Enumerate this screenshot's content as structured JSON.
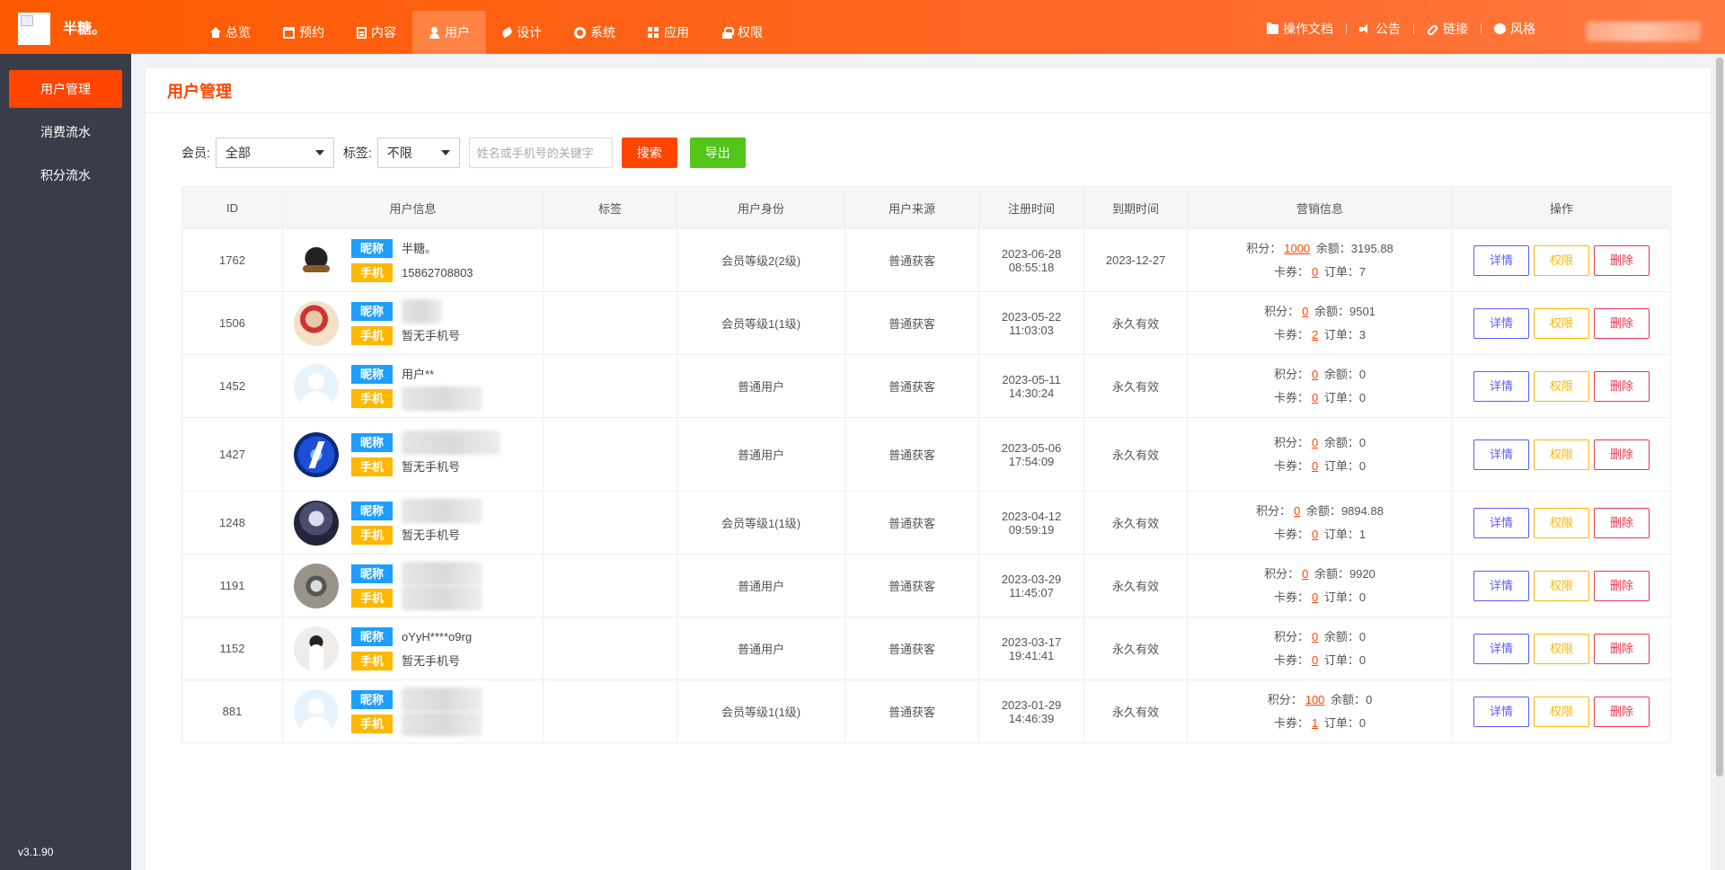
{
  "brand": {
    "name": "半糖。"
  },
  "nav": [
    {
      "label": "总览",
      "icon": "home-icon"
    },
    {
      "label": "预约",
      "icon": "calendar-icon"
    },
    {
      "label": "内容",
      "icon": "document-icon"
    },
    {
      "label": "用户",
      "icon": "user-icon",
      "active": true
    },
    {
      "label": "设计",
      "icon": "brush-icon"
    },
    {
      "label": "系统",
      "icon": "gear-icon"
    },
    {
      "label": "应用",
      "icon": "grid-icon"
    },
    {
      "label": "权限",
      "icon": "lock-icon"
    }
  ],
  "right_links": [
    {
      "label": "操作文档",
      "icon": "folder-icon"
    },
    {
      "label": "公告",
      "icon": "speaker-icon"
    },
    {
      "label": "链接",
      "icon": "link-icon"
    },
    {
      "label": "风格",
      "icon": "palette-icon"
    }
  ],
  "sidebar": {
    "items": [
      {
        "label": "用户管理",
        "active": true
      },
      {
        "label": "消费流水"
      },
      {
        "label": "积分流水"
      }
    ],
    "version": "v3.1.90"
  },
  "page": {
    "title": "用户管理"
  },
  "filter": {
    "member_label": "会员:",
    "member_value": "全部",
    "tag_label": "标签:",
    "tag_value": "不限",
    "search_placeholder": "姓名或手机号的关键字",
    "search_button": "搜索",
    "export_button": "导出"
  },
  "table": {
    "headers": [
      "ID",
      "用户信息",
      "标签",
      "用户身份",
      "用户来源",
      "注册时间",
      "到期时间",
      "营销信息",
      "操作"
    ],
    "nick_tag": "昵称",
    "phone_tag": "手机",
    "points_label": "积分：",
    "balance_label": "余额：",
    "coupon_label": "卡券：",
    "order_label": "订单：",
    "actions": {
      "detail": "详情",
      "perm": "权限",
      "delete": "删除"
    },
    "rows": [
      {
        "id": "1762",
        "nickname": "半糖。",
        "phone": "15862708803",
        "tag": "",
        "identity": "会员等级2(2级)",
        "source": "普通获客",
        "reg_date": "2023-06-28",
        "reg_time": "08:55:18",
        "expire": "2023-12-27",
        "points": "1000",
        "balance": "3195.88",
        "coupons": "0",
        "orders": "7"
      },
      {
        "id": "1506",
        "nickname": "",
        "phone": "暂无手机号",
        "tag": "",
        "identity": "会员等级1(1级)",
        "source": "普通获客",
        "reg_date": "2023-05-22",
        "reg_time": "11:03:03",
        "expire": "永久有效",
        "points": "0",
        "balance": "9501",
        "coupons": "2",
        "orders": "3"
      },
      {
        "id": "1452",
        "nickname": "用户**",
        "phone": "",
        "tag": "",
        "identity": "普通用户",
        "source": "普通获客",
        "reg_date": "2023-05-11",
        "reg_time": "14:30:24",
        "expire": "永久有效",
        "points": "0",
        "balance": "0",
        "coupons": "0",
        "orders": "0"
      },
      {
        "id": "1427",
        "nickname": "",
        "phone": "暂无手机号",
        "tag": "",
        "identity": "普通用户",
        "source": "普通获客",
        "reg_date": "2023-05-06",
        "reg_time": "17:54:09",
        "expire": "永久有效",
        "points": "0",
        "balance": "0",
        "coupons": "0",
        "orders": "0"
      },
      {
        "id": "1248",
        "nickname": "",
        "phone": "暂无手机号",
        "tag": "",
        "identity": "会员等级1(1级)",
        "source": "普通获客",
        "reg_date": "2023-04-12",
        "reg_time": "09:59:19",
        "expire": "永久有效",
        "points": "0",
        "balance": "9894.88",
        "coupons": "0",
        "orders": "1"
      },
      {
        "id": "1191",
        "nickname": "",
        "phone": "",
        "tag": "",
        "identity": "普通用户",
        "source": "普通获客",
        "reg_date": "2023-03-29",
        "reg_time": "11:45:07",
        "expire": "永久有效",
        "points": "0",
        "balance": "9920",
        "coupons": "0",
        "orders": "0"
      },
      {
        "id": "1152",
        "nickname": "oYyH****o9rg",
        "phone": "暂无手机号",
        "tag": "",
        "identity": "普通用户",
        "source": "普通获客",
        "reg_date": "2023-03-17",
        "reg_time": "19:41:41",
        "expire": "永久有效",
        "points": "0",
        "balance": "0",
        "coupons": "0",
        "orders": "0"
      },
      {
        "id": "881",
        "nickname": "",
        "phone": "",
        "tag": "",
        "identity": "会员等级1(1级)",
        "source": "普通获客",
        "reg_date": "2023-01-29",
        "reg_time": "14:46:39",
        "expire": "永久有效",
        "points": "100",
        "balance": "0",
        "coupons": "1",
        "orders": "0"
      }
    ]
  },
  "colors": {
    "accent": "#ff4500",
    "nick_tag": "#1e9fff",
    "phone_tag": "#ffb800",
    "export": "#52c41a"
  }
}
